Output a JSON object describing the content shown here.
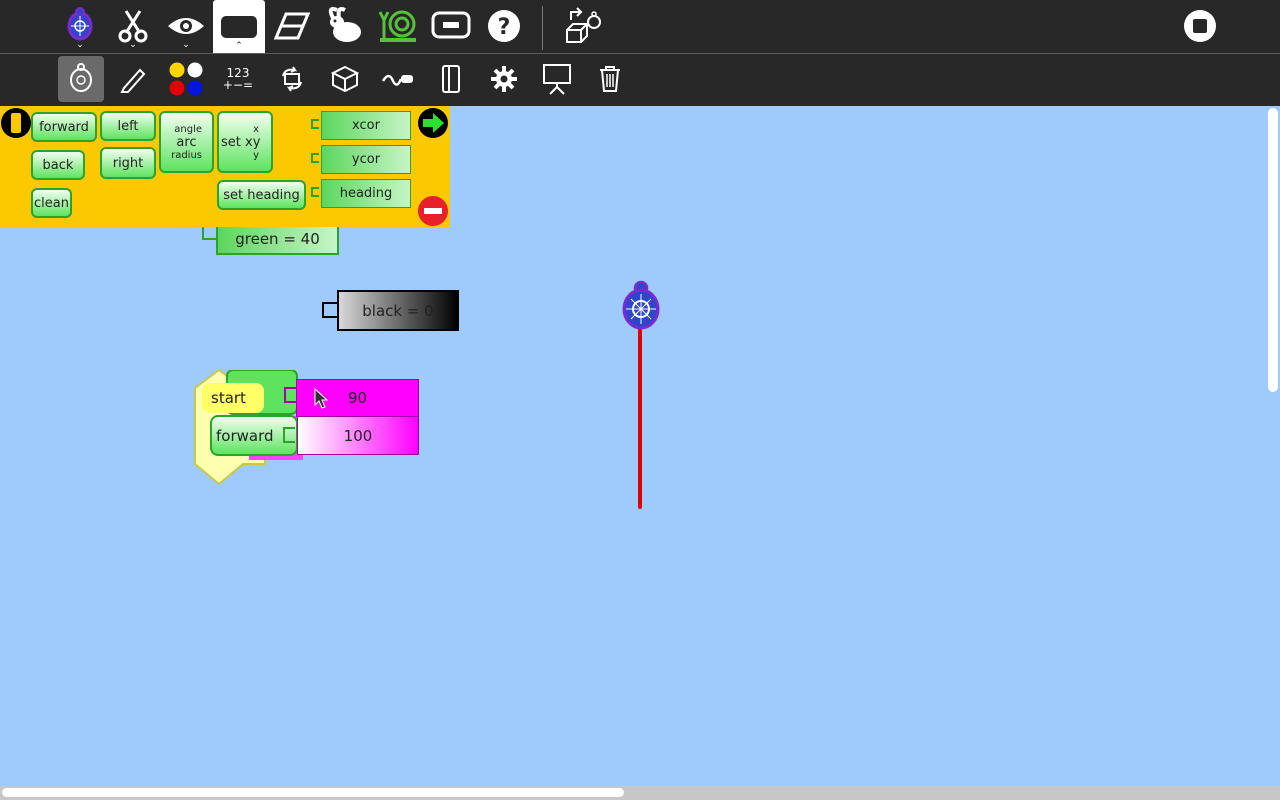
{
  "toolbar": {
    "icons": [
      "turtle-icon",
      "scissors-icon",
      "eye-icon",
      "tab-icon",
      "eraser-icon",
      "rabbit-icon",
      "snail-icon",
      "collapse-icon",
      "help-icon",
      "export-turtle-icon",
      "stop-icon"
    ]
  },
  "subtoolbar": {
    "icons": [
      "turtle-palette-icon",
      "pen-icon",
      "color-palette-icon",
      "number-palette-icon",
      "flow-icon",
      "box-icon",
      "action-icon",
      "extras-icon",
      "settings-icon",
      "presentation-icon",
      "trash-icon"
    ],
    "number_label_top": "123",
    "number_label_bottom": "+−="
  },
  "palette": {
    "blocks": {
      "forward": "forward",
      "back": "back",
      "clean": "clean",
      "left": "left",
      "right": "right",
      "angle": "angle",
      "arc": "arc",
      "radius": "radius",
      "set_xy": "set xy",
      "x": "x",
      "y": "y",
      "set_heading": "set heading",
      "xcor": "xcor",
      "ycor": "ycor",
      "heading": "heading"
    }
  },
  "canvas": {
    "green_block": "green = 40",
    "black_block": "black = 0",
    "start_block": "start",
    "forward_block": "forward",
    "arg_90": "90",
    "arg_100": "100"
  },
  "colors": {
    "background": "#9ecbfc",
    "toolbar": "#282828",
    "palette": "#fcc800",
    "pen_line": "#e00000",
    "magenta": "#ff00ff"
  }
}
